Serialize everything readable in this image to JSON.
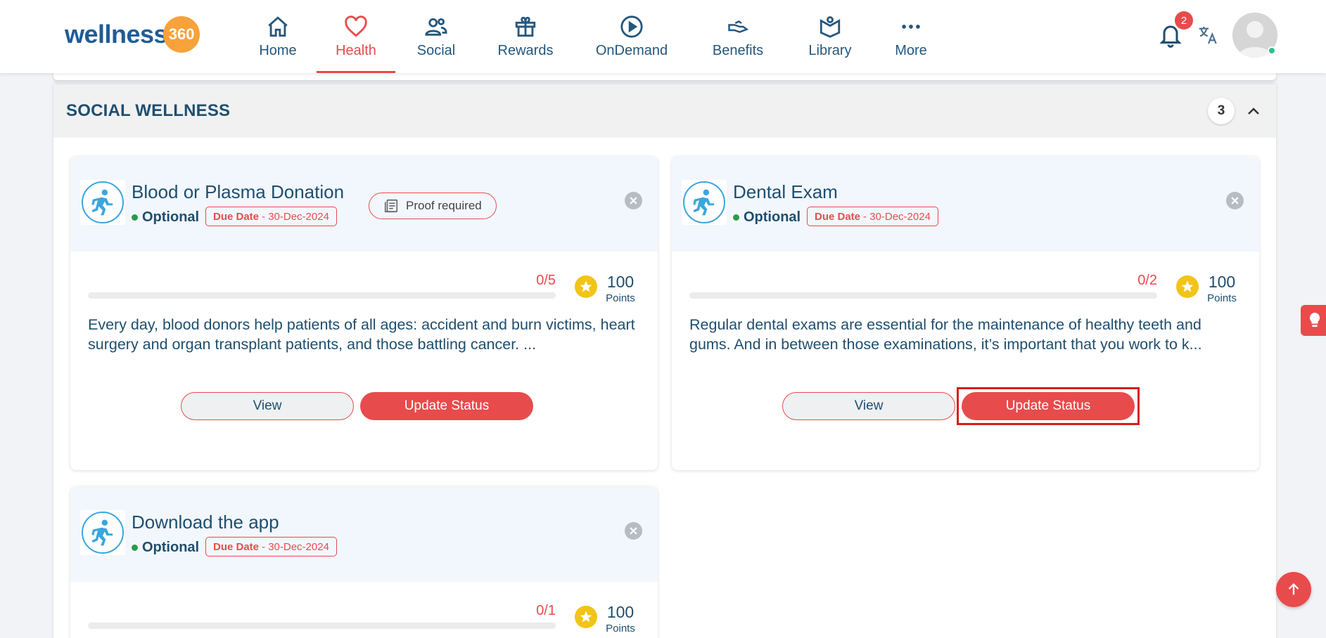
{
  "app": {
    "logo_text": "wellness",
    "logo_badge_num": "360"
  },
  "nav": {
    "home": "Home",
    "health": "Health",
    "social": "Social",
    "rewards": "Rewards",
    "ondemand": "OnDemand",
    "benefits": "Benefits",
    "library": "Library",
    "more": "More"
  },
  "header": {
    "notification_count": "2"
  },
  "section": {
    "title": "SOCIAL WELLNESS",
    "count": "3"
  },
  "cards": [
    {
      "title": "Blood or Plasma Donation",
      "optional": "Optional",
      "due_label": "Due Date",
      "due_value": "- 30-Dec-2024",
      "proof": "Proof required",
      "progress": "0/5",
      "progress_fraction": 0,
      "points": "100",
      "points_label": "Points",
      "description": "Every day, blood donors help patients of all ages: accident and burn victims, heart surgery and organ transplant patients, and those battling cancer. ...",
      "view": "View",
      "update": "Update Status"
    },
    {
      "title": "Dental Exam",
      "optional": "Optional",
      "due_label": "Due Date",
      "due_value": "- 30-Dec-2024",
      "progress": "0/2",
      "progress_fraction": 0,
      "points": "100",
      "points_label": "Points",
      "description": "Regular dental exams are essential for the maintenance of healthy teeth and gums. And in between those examinations, it’s important that you work to k...",
      "view": "View",
      "update": "Update Status"
    },
    {
      "title": "Download the app",
      "optional": "Optional",
      "due_label": "Due Date",
      "due_value": "- 30-Dec-2024",
      "progress": "0/1",
      "progress_fraction": 0,
      "points": "100",
      "points_label": "Points"
    }
  ],
  "colors": {
    "accent": "#e84b4b",
    "text": "#1f4e6e",
    "brand_orange": "#f7a23a",
    "online": "#2fbf8e"
  }
}
